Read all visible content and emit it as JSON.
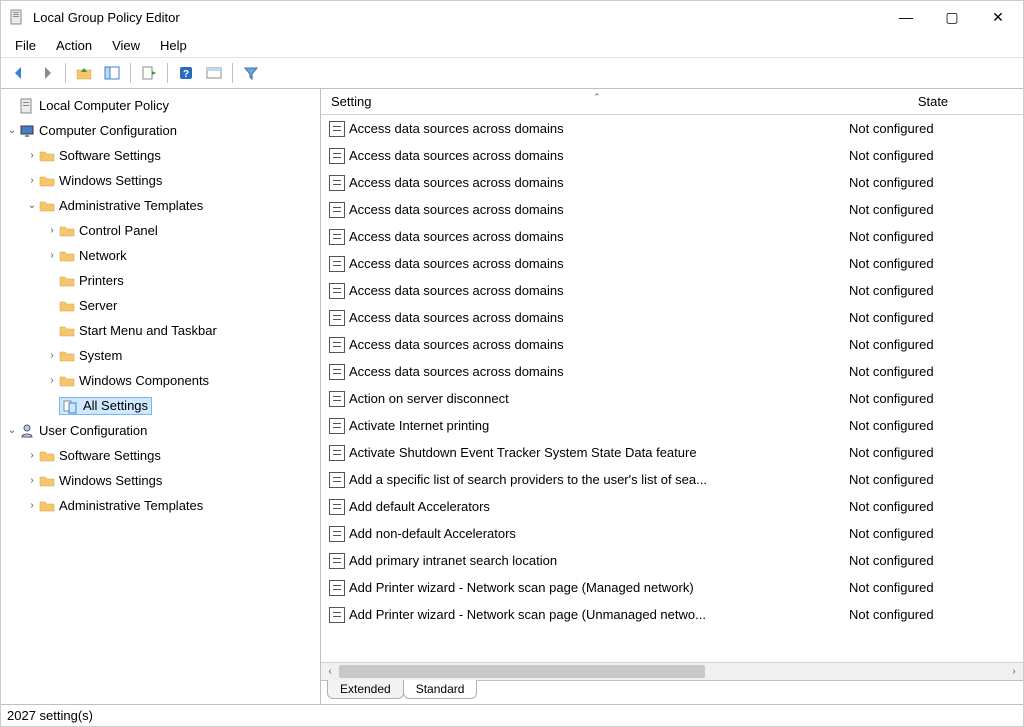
{
  "window": {
    "title": "Local Group Policy Editor"
  },
  "menu": {
    "file": "File",
    "action": "Action",
    "view": "View",
    "help": "Help"
  },
  "tree": {
    "root": "Local Computer Policy",
    "computer_config": "Computer Configuration",
    "cc_software": "Software Settings",
    "cc_windows": "Windows Settings",
    "cc_admin": "Administrative Templates",
    "at_control_panel": "Control Panel",
    "at_network": "Network",
    "at_printers": "Printers",
    "at_server": "Server",
    "at_startmenu": "Start Menu and Taskbar",
    "at_system": "System",
    "at_components": "Windows Components",
    "at_all": "All Settings",
    "user_config": "User Configuration",
    "uc_software": "Software Settings",
    "uc_windows": "Windows Settings",
    "uc_admin": "Administrative Templates"
  },
  "columns": {
    "setting": "Setting",
    "state": "State"
  },
  "rows": [
    {
      "name": "Access data sources across domains",
      "state": "Not configured"
    },
    {
      "name": "Access data sources across domains",
      "state": "Not configured"
    },
    {
      "name": "Access data sources across domains",
      "state": "Not configured"
    },
    {
      "name": "Access data sources across domains",
      "state": "Not configured"
    },
    {
      "name": "Access data sources across domains",
      "state": "Not configured"
    },
    {
      "name": "Access data sources across domains",
      "state": "Not configured"
    },
    {
      "name": "Access data sources across domains",
      "state": "Not configured"
    },
    {
      "name": "Access data sources across domains",
      "state": "Not configured"
    },
    {
      "name": "Access data sources across domains",
      "state": "Not configured"
    },
    {
      "name": "Access data sources across domains",
      "state": "Not configured"
    },
    {
      "name": "Action on server disconnect",
      "state": "Not configured"
    },
    {
      "name": "Activate Internet printing",
      "state": "Not configured"
    },
    {
      "name": "Activate Shutdown Event Tracker System State Data feature",
      "state": "Not configured"
    },
    {
      "name": "Add a specific list of search providers to the user's list of sea...",
      "state": "Not configured"
    },
    {
      "name": "Add default Accelerators",
      "state": "Not configured"
    },
    {
      "name": "Add non-default Accelerators",
      "state": "Not configured"
    },
    {
      "name": "Add primary intranet search location",
      "state": "Not configured"
    },
    {
      "name": "Add Printer wizard - Network scan page (Managed network)",
      "state": "Not configured"
    },
    {
      "name": "Add Printer wizard - Network scan page (Unmanaged netwo...",
      "state": "Not configured"
    }
  ],
  "tabs": {
    "extended": "Extended",
    "standard": "Standard"
  },
  "status": {
    "count": "2027 setting(s)"
  }
}
